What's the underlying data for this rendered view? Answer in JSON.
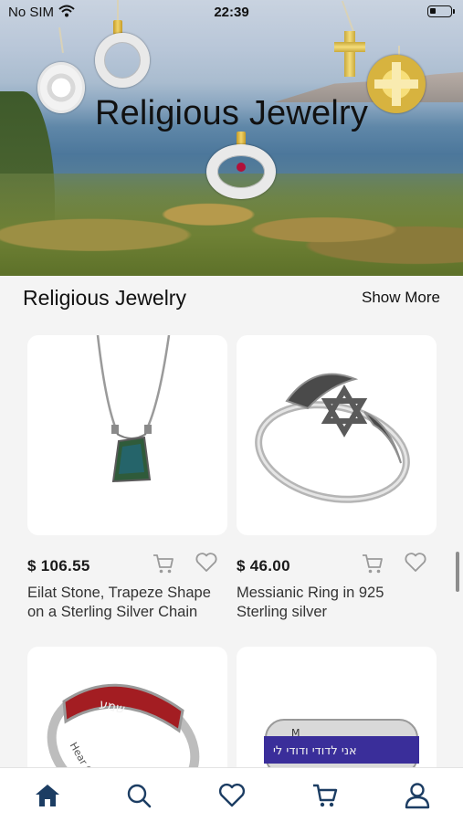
{
  "status_bar": {
    "carrier": "No SIM",
    "time": "22:39"
  },
  "hero": {
    "title": "Religious Jewelry"
  },
  "section": {
    "title": "Religious Jewelry",
    "show_more_label": "Show More"
  },
  "products": [
    {
      "price": "$ 106.55",
      "name": "Eilat Stone, Trapeze Shape on a Sterling Silver Chain"
    },
    {
      "price": "$ 46.00",
      "name": "Messianic Ring in 925 Sterling silver"
    }
  ],
  "tabbar": {
    "items": [
      "home-icon",
      "search-icon",
      "heart-icon",
      "cart-icon",
      "user-icon"
    ],
    "active": "home-icon",
    "accent_color": "#1c3d63"
  }
}
